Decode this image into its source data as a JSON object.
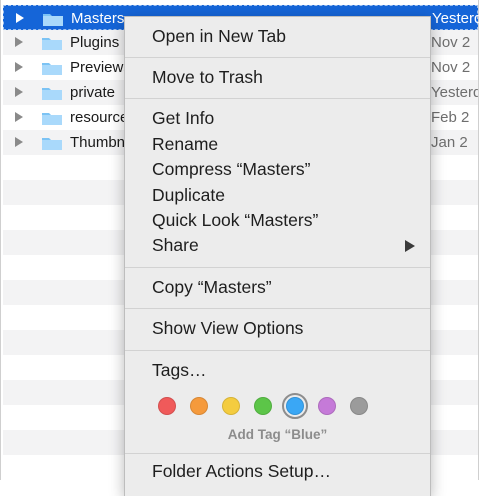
{
  "finder": {
    "rows": [
      {
        "name": "Masters",
        "date": "Yesterday"
      },
      {
        "name": "Plugins",
        "date": "Nov 2"
      },
      {
        "name": "Previews",
        "date": "Nov 2"
      },
      {
        "name": "private",
        "date": "Yesterday"
      },
      {
        "name": "resources",
        "date": "Feb 2"
      },
      {
        "name": "Thumbnails",
        "date": "Jan 2"
      }
    ]
  },
  "menu": {
    "open_new_tab": "Open in New Tab",
    "move_to_trash": "Move to Trash",
    "get_info": "Get Info",
    "rename": "Rename",
    "compress": "Compress “Masters”",
    "duplicate": "Duplicate",
    "quick_look": "Quick Look “Masters”",
    "share": "Share",
    "copy": "Copy “Masters”",
    "show_view_options": "Show View Options",
    "tags": "Tags…",
    "add_tag_hint": "Add Tag “Blue”",
    "folder_actions": "Folder Actions Setup…"
  },
  "tag_colors": {
    "red": "#f05a5a",
    "orange": "#f59a3c",
    "yellow": "#f4cc3f",
    "green": "#5cc548",
    "blue": "#3aa7f5",
    "purple": "#c57ad8",
    "gray": "#9b9b9b"
  }
}
